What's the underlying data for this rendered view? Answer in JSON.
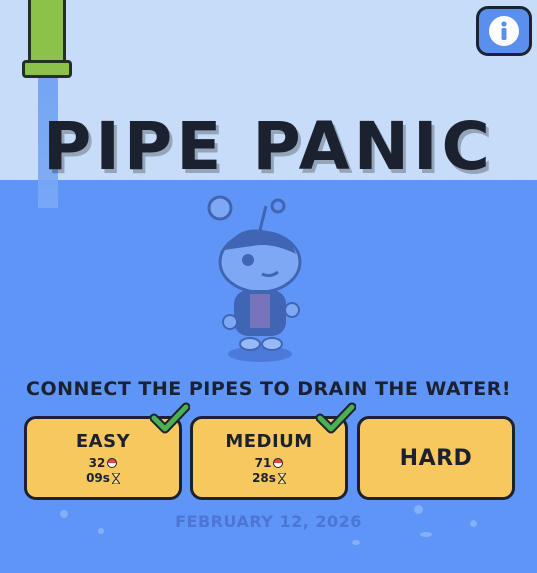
{
  "game": {
    "title": "PIPE PANIC",
    "instruction": "CONNECT THE PIPES TO DRAIN THE WATER!",
    "date": "FEBRUARY 12, 2026"
  },
  "difficulties": [
    {
      "label": "EASY",
      "score": "32",
      "time": "09s",
      "completed": true
    },
    {
      "label": "MEDIUM",
      "score": "71",
      "time": "28s",
      "completed": true
    },
    {
      "label": "HARD",
      "completed": false
    }
  ],
  "icons": {
    "info": "info-icon",
    "check": "checkmark-icon",
    "score": "pokeball-icon",
    "time": "hourglass-icon"
  },
  "colors": {
    "sky": "#c6dcf8",
    "water": "#5f95f7",
    "button": "#f6c85e",
    "check": "#4caf50",
    "pipe": "#8dc24a"
  }
}
